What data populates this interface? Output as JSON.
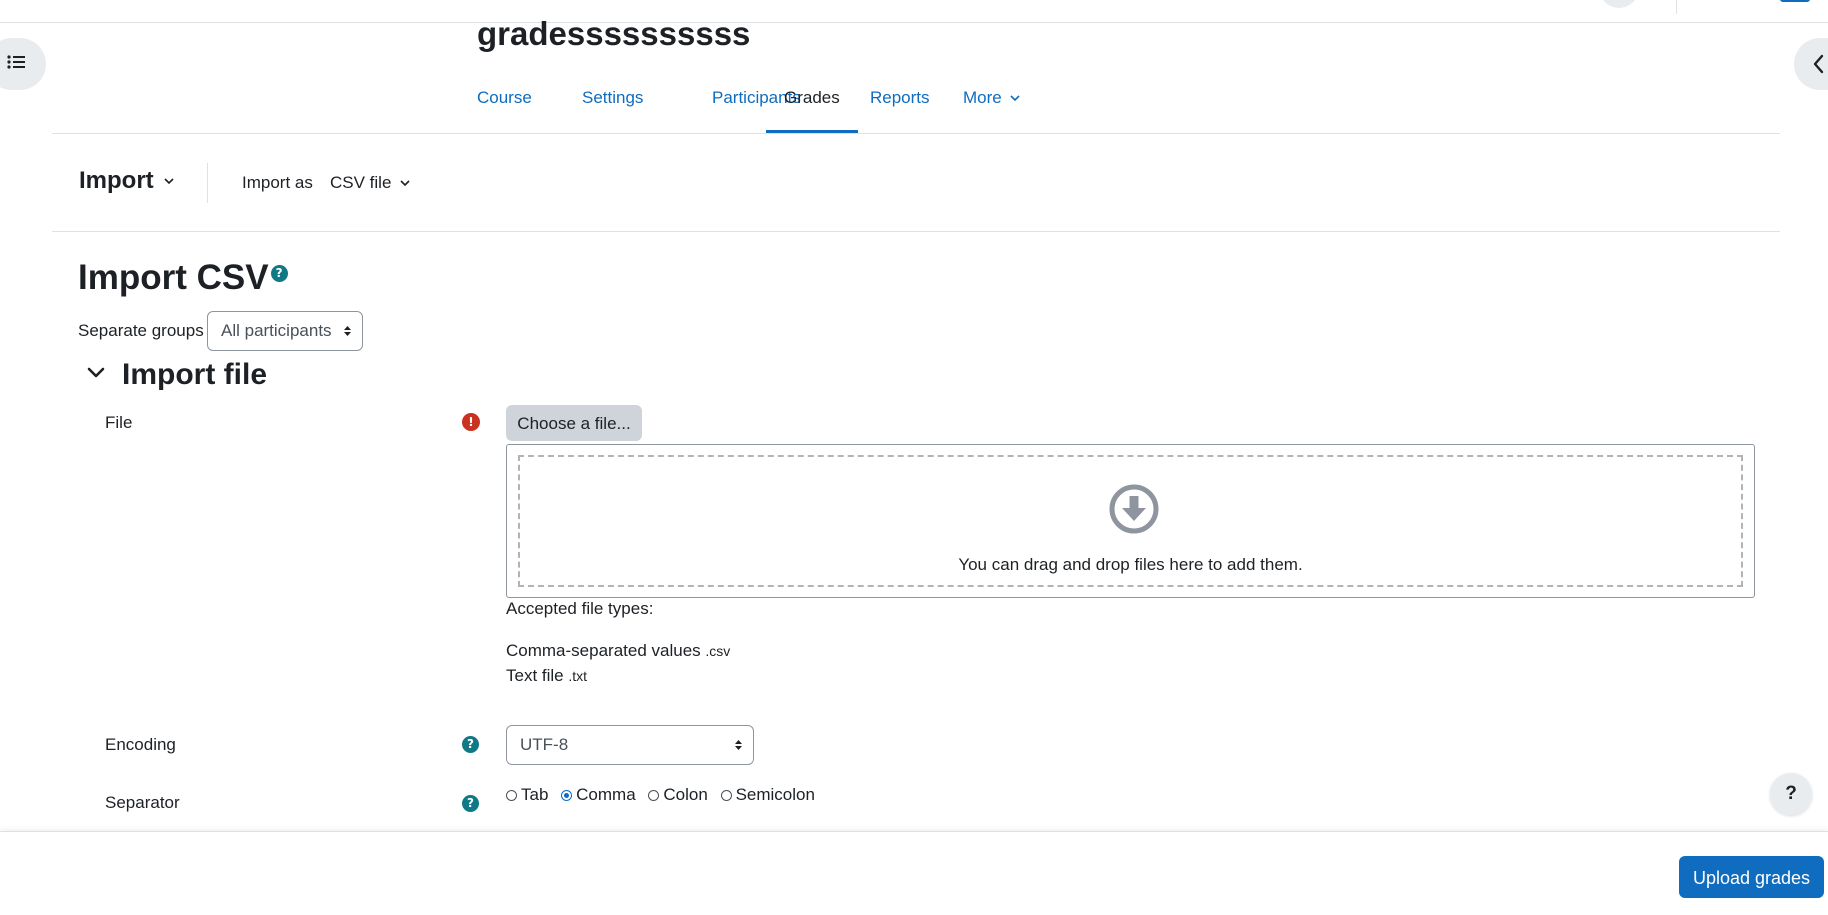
{
  "course": {
    "title": "gradessssssssss"
  },
  "nav": {
    "tabs": [
      {
        "label": "Course"
      },
      {
        "label": "Settings"
      },
      {
        "label": "Participants"
      },
      {
        "label": "Grades"
      },
      {
        "label": "Reports"
      },
      {
        "label": "More"
      }
    ],
    "active": "Grades"
  },
  "tertiary": {
    "import_label": "Import",
    "import_as_label": "Import as",
    "import_as_value": "CSV file"
  },
  "page": {
    "heading": "Import CSV",
    "help_glyph": "?"
  },
  "groups": {
    "label": "Separate groups",
    "selected": "All participants"
  },
  "section": {
    "title": "Import file"
  },
  "file_field": {
    "label": "File",
    "required_glyph": "!",
    "choose_button": "Choose a file...",
    "drop_text": "You can drag and drop files here to add them.",
    "accepted_title": "Accepted file types:",
    "types": [
      {
        "name": "Comma-separated values",
        "ext": ".csv"
      },
      {
        "name": "Text file",
        "ext": ".txt"
      }
    ]
  },
  "encoding": {
    "label": "Encoding",
    "selected": "UTF-8"
  },
  "separator": {
    "label": "Separator",
    "options": [
      {
        "label": "Tab",
        "checked": false
      },
      {
        "label": "Comma",
        "checked": true
      },
      {
        "label": "Colon",
        "checked": false
      },
      {
        "label": "Semicolon",
        "checked": false
      }
    ]
  },
  "footer": {
    "upload_button": "Upload grades"
  },
  "help_float": {
    "glyph": "?"
  },
  "colors": {
    "link": "#0f6cbf",
    "text": "#1d2125",
    "help_badge": "#0f7986",
    "required": "#ca3120",
    "button_secondary": "#ced4da",
    "primary_button": "#0f6cbf"
  },
  "icons": {
    "left_drawer": "list-icon",
    "right_drawer": "chevron-left-icon",
    "drop": "download-arrow-circle-icon",
    "section_toggle": "chevron-down-icon"
  }
}
